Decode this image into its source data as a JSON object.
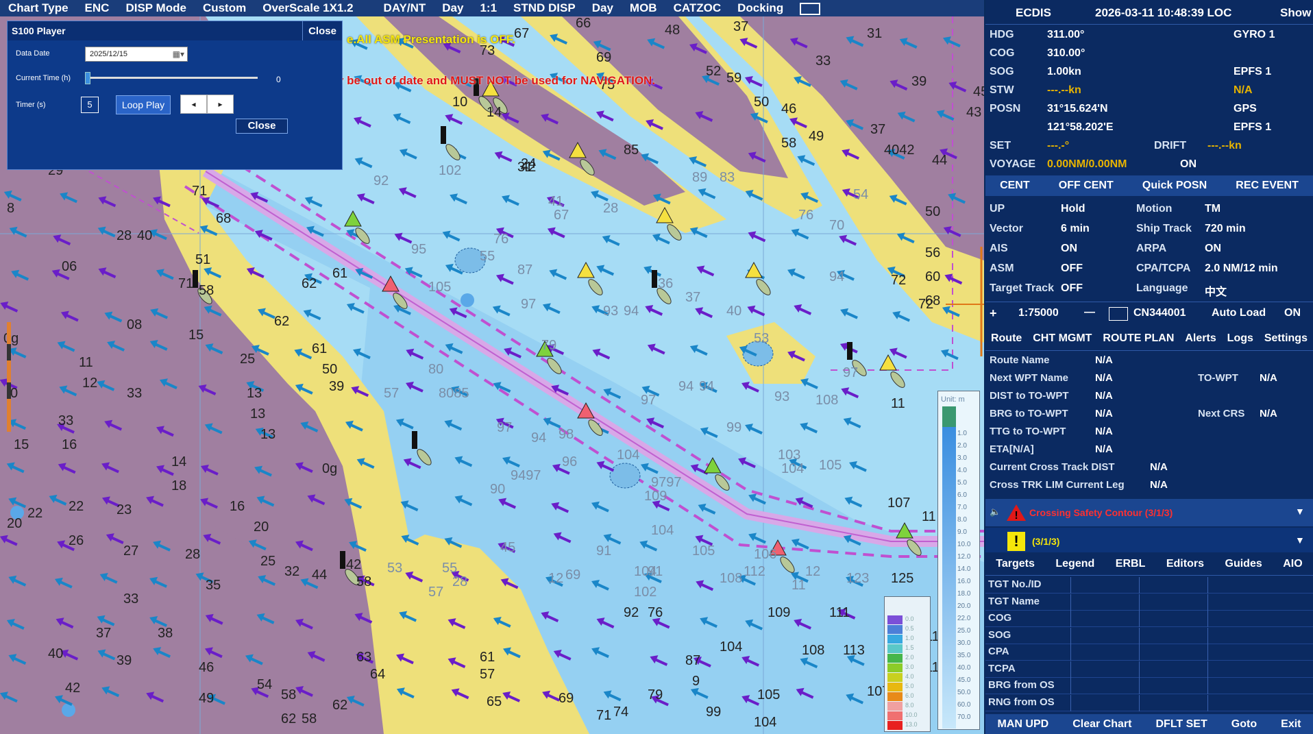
{
  "topbar": {
    "items": [
      "Chart Type",
      "ENC",
      "DISP Mode",
      "Custom",
      "OverScale 1X1.2",
      "DAY/NT",
      "Day",
      "1:1",
      "STND DISP",
      "Day",
      "MOB",
      "CATZOC",
      "Docking"
    ]
  },
  "warnings": {
    "asm": "e.All ASM Presentation is OFF.",
    "nav": "y be out of date and MUST NOT be used for NAVIGATION."
  },
  "player": {
    "title": "S100 Player",
    "close_header": "Close",
    "data_date_label": "Data Date",
    "data_date": "2025/12/15",
    "current_time_label": "Current Time (h)",
    "current_time": "0",
    "current_time_fraction": 0,
    "timer_label": "Timer (s)",
    "timer_value": "5",
    "loop_play": "Loop Play",
    "prev": "◂",
    "next": "▸",
    "close_button": "Close"
  },
  "header": {
    "app": "ECDIS",
    "datetime": "2026-03-11 10:48:39 LOC",
    "show": "Show"
  },
  "nav": {
    "hdg_label": "HDG",
    "hdg": "311.00°",
    "hdg_src": "GYRO 1",
    "cog_label": "COG",
    "cog": "310.00°",
    "sog_label": "SOG",
    "sog": "1.00kn",
    "sog_src": "EPFS 1",
    "stw_label": "STW",
    "stw": "---.--kn",
    "stw_src": "N/A",
    "posn_label": "POSN",
    "lat": "31°15.624'N",
    "lat_src": "GPS",
    "lon": "121°58.202'E",
    "lon_src": "EPFS 1",
    "set_label": "SET",
    "set": "---.-°",
    "drift_label": "DRIFT",
    "drift": "---.--kn",
    "voyage_label": "VOYAGE",
    "voyage": "0.00NM/0.00NM",
    "voyage_state": "ON"
  },
  "cent": [
    "CENT",
    "OFF CENT",
    "Quick POSN",
    "REC EVENT"
  ],
  "settings": {
    "up_label": "UP",
    "up": "Hold",
    "motion_label": "Motion",
    "motion": "TM",
    "vector_label": "Vector",
    "vector": "6 min",
    "track_label": "Ship Track",
    "track": "720 min",
    "ais_label": "AIS",
    "ais": "ON",
    "arpa_label": "ARPA",
    "arpa": "ON",
    "asm_label": "ASM",
    "asm": "OFF",
    "cpa_label": "CPA/TCPA",
    "cpa": "2.0 NM/12 min",
    "tt_label": "Target Track",
    "tt": "OFF",
    "lang_label": "Language",
    "lang": "中文"
  },
  "scale": {
    "plus": "+",
    "value": "1:75000",
    "minus": "—",
    "chart_id": "CN344001",
    "autoload_label": "Auto Load",
    "autoload": "ON"
  },
  "tabs1": [
    "Route",
    "CHT MGMT",
    "ROUTE PLAN",
    "Alerts",
    "Logs",
    "Settings"
  ],
  "route": {
    "name_label": "Route Name",
    "name": "N/A",
    "next_label": "Next WPT Name",
    "next": "N/A",
    "towpt_label": "TO-WPT",
    "towpt": "N/A",
    "dist_label": "DIST to TO-WPT",
    "dist": "N/A",
    "brg_label": "BRG to TO-WPT",
    "brg": "N/A",
    "nextcrs_label": "Next CRS",
    "nextcrs": "N/A",
    "ttg_label": "TTG to TO-WPT",
    "ttg": "N/A",
    "eta_label": "ETA[N/A]",
    "eta": "N/A",
    "xtd_label": "Current Cross Track DIST",
    "xtd": "N/A",
    "xtl_label": "Cross TRK LIM Current Leg",
    "xtl": "N/A"
  },
  "alerts": {
    "alert1": "Crossing Safety Contour (3/1/3)",
    "alert2": "(3/1/3)"
  },
  "tabs2": [
    "Targets",
    "Legend",
    "ERBL",
    "Editors",
    "Guides",
    "AIO"
  ],
  "targets": [
    "TGT No./ID",
    "TGT Name",
    "COG",
    "SOG",
    "CPA",
    "TCPA",
    "BRG from OS",
    "RNG from OS"
  ],
  "bottom": [
    "MAN UPD",
    "Clear Chart",
    "DFLT SET",
    "Goto",
    "Exit"
  ],
  "depth_legend": {
    "unit": "Unit: m",
    "values": [
      "1.0",
      "2.0",
      "3.0",
      "4.0",
      "5.0",
      "6.0",
      "7.0",
      "8.0",
      "9.0",
      "10.0",
      "12.0",
      "14.0",
      "16.0",
      "18.0",
      "20.0",
      "22.0",
      "25.0",
      "30.0",
      "35.0",
      "40.0",
      "45.0",
      "50.0",
      "60.0",
      "70.0"
    ]
  },
  "safety_legend": {
    "values": [
      "0.0",
      "0.5",
      "1.0",
      "1.5",
      "2.0",
      "3.0",
      "4.0",
      "5.0",
      "6.0",
      "8.0",
      "10.0",
      "13.0"
    ],
    "colors": [
      "#7b4fd8",
      "#4c7fd8",
      "#38a9e0",
      "#5ac8c8",
      "#46b64a",
      "#8ccc28",
      "#c8d020",
      "#e8b810",
      "#e88a18",
      "#f0a0a0",
      "#f07070",
      "#e82020"
    ]
  },
  "colors": {
    "panel_bg": "#0b2a61",
    "chart_water": "#a6dcf5",
    "land": "#eee07a",
    "deep_land": "#a07fa0",
    "route": "#c85ad8",
    "alert_red": "#e01818",
    "warn_yellow": "#f5e60a"
  }
}
